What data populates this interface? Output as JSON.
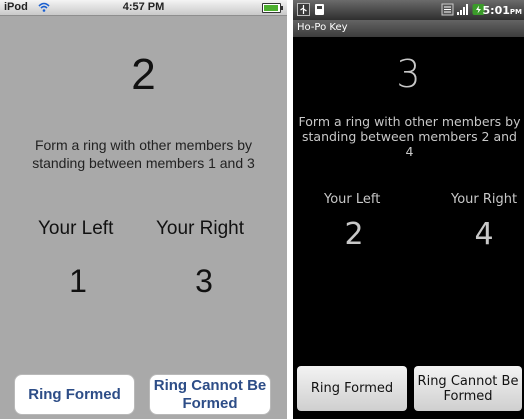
{
  "ios": {
    "status": {
      "carrier": "iPod",
      "time": "4:57 PM",
      "battery_level": 0.95,
      "battery_color": "#4caf2e"
    },
    "number": "2",
    "instruction": "Form a ring with other members by standing between members 1 and 3",
    "left_label": "Your Left",
    "right_label": "Your Right",
    "left_value": "1",
    "right_value": "3",
    "ring_formed_label": "Ring Formed",
    "ring_cannot_label": "Ring Cannot Be Formed",
    "button_text_color": "#2d4d87"
  },
  "android": {
    "status": {
      "time": "5:01",
      "time_suffix": "PM",
      "icons": [
        "usb-icon",
        "sd-card-icon",
        "network-icon",
        "signal-icon",
        "battery-icon"
      ]
    },
    "app_title": "Ho-Po Key",
    "number": "3",
    "instruction": "Form a ring with other members by standing between members 2 and 4",
    "left_label": "Your Left",
    "right_label": "Your Right",
    "left_value": "2",
    "right_value": "4",
    "ring_formed_label": "Ring Formed",
    "ring_cannot_label": "Ring Cannot Be Formed"
  }
}
